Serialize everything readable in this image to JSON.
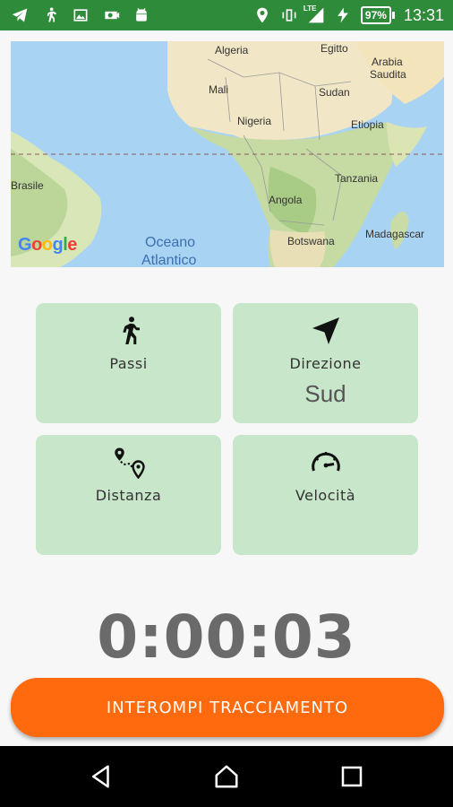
{
  "status_bar": {
    "battery_percent": "97%",
    "network_type": "LTE",
    "time": "13:31",
    "left_icons": [
      "telegram-icon",
      "walking-icon",
      "image-icon",
      "camera-icon",
      "android-icon"
    ],
    "right_icons": [
      "location-icon",
      "vibrate-icon",
      "signal-icon",
      "charging-icon",
      "battery-icon"
    ],
    "background_color": "#2e8b3a"
  },
  "map": {
    "brand": "Google",
    "labels": {
      "algeria": "Algeria",
      "egitto": "Egitto",
      "arabia": "Arabia",
      "saudita": "Saudita",
      "mali": "Mali",
      "sudan": "Sudan",
      "nigeria": "Nigeria",
      "etiopia": "Etiopia",
      "brasile": "Brasile",
      "tanzania": "Tanzania",
      "angola": "Angola",
      "madagascar": "Madagascar",
      "botswana": "Botswana",
      "oceano": "Oceano",
      "atlantico": "Atlantico"
    }
  },
  "cards": {
    "passi": {
      "label": "Passi",
      "value": "",
      "icon": "walking-icon"
    },
    "direzione": {
      "label": "Direzione",
      "value": "Sud",
      "icon": "navigation-arrow-icon"
    },
    "distanza": {
      "label": "Distanza",
      "value": "",
      "icon": "route-icon"
    },
    "velocita": {
      "label": "Velocità",
      "value": "",
      "icon": "speedometer-icon"
    },
    "color": "#c8e6c9"
  },
  "timer": {
    "value": "0:00:03"
  },
  "stop_button": {
    "label": "INTEROMPI TRACCIAMENTO",
    "color": "#ff6a0e"
  },
  "nav_bar": {
    "icons": [
      "back-icon",
      "home-icon",
      "recents-icon"
    ]
  }
}
